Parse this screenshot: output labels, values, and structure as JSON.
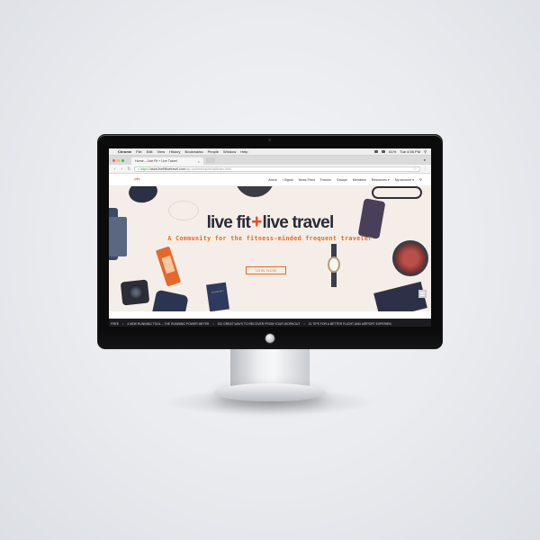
{
  "menubar": {
    "app_name": "Chrome",
    "items": [
      "File",
      "Edit",
      "View",
      "History",
      "Bookmarks",
      "People",
      "Window",
      "Help"
    ],
    "battery": "61%",
    "clock": "Tue 4:56 PM"
  },
  "browser": {
    "tab_title": "Home – Live Fit + Live Travel",
    "tab_close": "×",
    "address": {
      "scheme": "https://",
      "host": "www.livefitlivetravel.com",
      "path": "/wp-content/cache/all/index.html"
    }
  },
  "site": {
    "logo": "‹+›",
    "nav": [
      "About",
      "I Signal",
      "News Feed",
      "Forums",
      "Groups",
      "Members",
      "Resources ▾",
      "My account ▾"
    ],
    "search_icon": "⚲"
  },
  "hero": {
    "title_left": "live fit",
    "title_plus": "+",
    "title_right": "live travel",
    "subtitle": "A Community for the fitness-minded frequent traveler",
    "join_label": "JOIN NOW",
    "passport_label": "PASSPORT"
  },
  "ticker": {
    "items": [
      "FREE",
      "4 NEW RUNNING TOOL – THE RUNNING POWER METER",
      "SIX GREAT WAYS TO RECOVER FROM YOUR WORKOUT",
      "21 TIPS FOR A BETTER FLIGHT AND AIRPORT EXPERIEN"
    ],
    "separator": "•"
  },
  "colors": {
    "accent": "#e8691f",
    "plus_red": "#ea4a1c",
    "hero_bg": "#f5eee8",
    "title_dark": "#2a2b36"
  }
}
